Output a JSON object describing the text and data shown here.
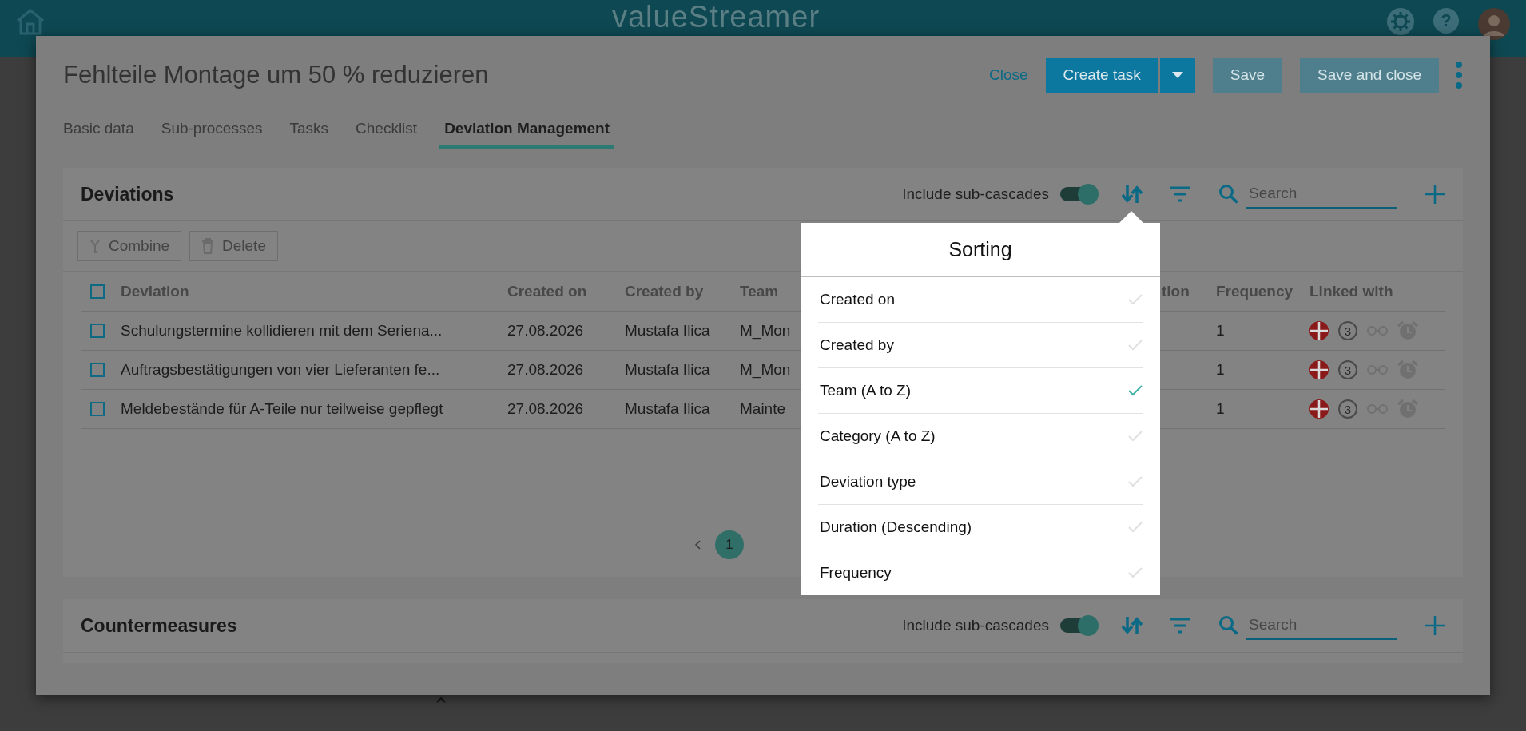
{
  "header": {
    "logo": "valueStreamer",
    "help": "?"
  },
  "dialog": {
    "title": "Fehlteile Montage um 50 % reduzieren",
    "actions": [
      {
        "label": "Close",
        "kind": "link",
        "disabled": false
      },
      {
        "label": "Create task",
        "kind": "split",
        "disabled": false
      },
      {
        "label": "Save",
        "kind": "primary",
        "disabled": true
      },
      {
        "label": "Save and close",
        "kind": "primary",
        "disabled": true
      }
    ]
  },
  "tabs": [
    {
      "label": "Basic data",
      "selected": false
    },
    {
      "label": "Sub-processes",
      "selected": false
    },
    {
      "label": "Tasks",
      "selected": false
    },
    {
      "label": "Checklist",
      "selected": false
    },
    {
      "label": "Deviation Management",
      "selected": true
    }
  ],
  "deviations": {
    "title": "Deviations",
    "sub_cascades": {
      "label": "Include sub-cascades",
      "on": true
    },
    "search": {
      "placeholder": "Search"
    },
    "toolbar": [
      {
        "label": "Combine",
        "kind": "merge",
        "disabled": true
      },
      {
        "label": "Delete",
        "kind": "trash",
        "disabled": true
      }
    ],
    "table": {
      "all_checked": false,
      "columns": [
        "Deviation",
        "Created on",
        "Created by",
        "Team",
        "tion",
        "Frequency",
        "Linked with"
      ],
      "rows": [
        {
          "checked": false,
          "cells": [
            "Schulungstermine kollidieren mit dem Seriena...",
            "27.08.2026",
            "Mustafa Ilica",
            "M_Mon",
            "",
            "1"
          ],
          "linked_count": "3"
        },
        {
          "checked": false,
          "cells": [
            "Auftragsbestätigungen von vier Lieferanten fe...",
            "27.08.2026",
            "Mustafa Ilica",
            "M_Mon",
            "",
            "1"
          ],
          "linked_count": "3"
        },
        {
          "checked": false,
          "cells": [
            "Meldebestände für A-Teile nur teilweise gepflegt",
            "27.08.2026",
            "Mustafa Ilica",
            "Mainte",
            "",
            "1"
          ],
          "linked_count": "3"
        }
      ]
    },
    "pages": [
      {
        "label": "1",
        "selected": true
      }
    ]
  },
  "sorting": {
    "title": "Sorting",
    "options": [
      {
        "label": "Created on",
        "selected": false
      },
      {
        "label": "Created by",
        "selected": false
      },
      {
        "label": "Team (A to Z)",
        "selected": true
      },
      {
        "label": "Category (A to Z)",
        "selected": false
      },
      {
        "label": "Deviation type",
        "selected": false
      },
      {
        "label": "Duration (Descending)",
        "selected": false
      },
      {
        "label": "Frequency",
        "selected": false
      }
    ]
  },
  "countermeasures": {
    "title": "Countermeasures",
    "sub_cascades": {
      "label": "Include sub-cascades",
      "on": true
    },
    "search": {
      "placeholder": "Search"
    }
  }
}
